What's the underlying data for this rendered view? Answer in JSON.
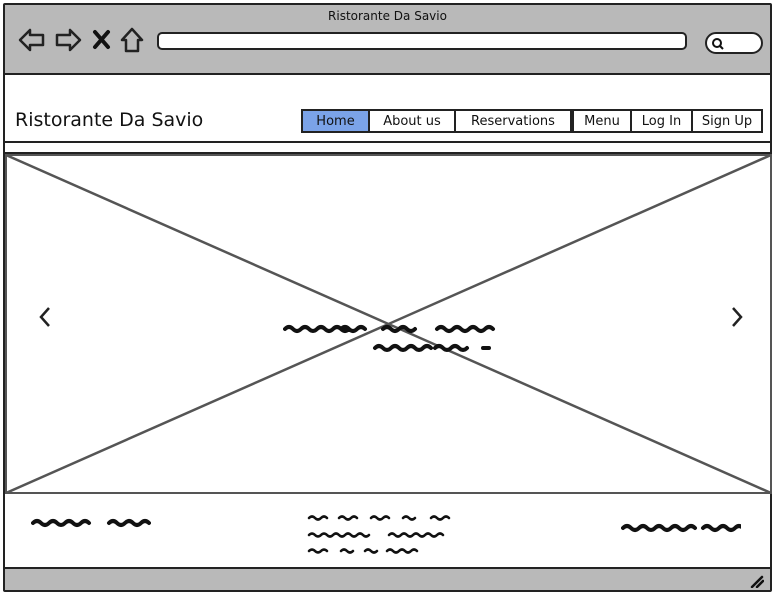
{
  "window": {
    "title": "Ristorante Da Savio"
  },
  "browser": {
    "back_icon": "back-arrow-icon",
    "forward_icon": "forward-arrow-icon",
    "stop_icon": "close-icon",
    "home_icon": "home-icon",
    "search_icon": "search-icon",
    "url_value": ""
  },
  "header": {
    "brand": "Ristorante Da Savio",
    "nav": [
      {
        "label": "Home",
        "active": true
      },
      {
        "label": "About us",
        "active": false
      },
      {
        "label": "Reservations",
        "active": false
      },
      {
        "label": "Menu",
        "active": false
      },
      {
        "label": "Log In",
        "active": false
      },
      {
        "label": "Sign Up",
        "active": false
      }
    ]
  },
  "hero": {
    "placeholder": "image-placeholder",
    "prev_icon": "chevron-left-icon",
    "next_icon": "chevron-right-icon"
  },
  "colors": {
    "chrome": "#b9b9b9",
    "active_nav": "#7ba3e8",
    "stroke": "#222222"
  }
}
